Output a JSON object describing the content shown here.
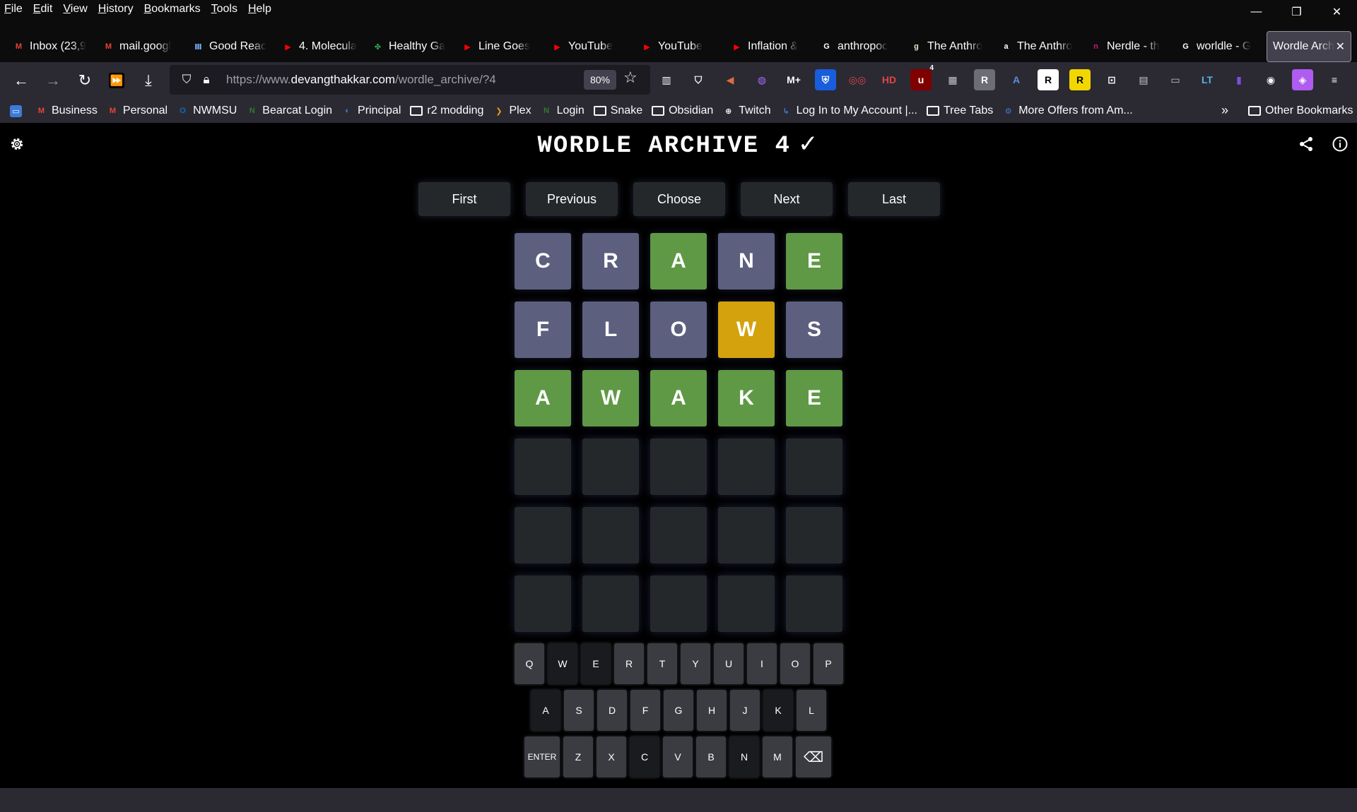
{
  "menubar": {
    "items": [
      "File",
      "Edit",
      "View",
      "History",
      "Bookmarks",
      "Tools",
      "Help"
    ]
  },
  "tabs": [
    {
      "label": "Inbox (23,9",
      "icon": "gmail-icon",
      "color": "#ea4335",
      "glyph": "M"
    },
    {
      "label": "mail.googl",
      "icon": "gmail-icon",
      "color": "#ea4335",
      "glyph": "M"
    },
    {
      "label": "Good Reac",
      "icon": "library-icon",
      "color": "#7ab4ff",
      "glyph": "Ⅲ"
    },
    {
      "label": "4. Molecula",
      "icon": "youtube-icon",
      "color": "#ff0000",
      "glyph": "▶"
    },
    {
      "label": "Healthy Ga",
      "icon": "plant-icon",
      "color": "#2fa84f",
      "glyph": "✤"
    },
    {
      "label": "Line Goes",
      "icon": "youtube-icon",
      "color": "#ff0000",
      "glyph": "▶"
    },
    {
      "label": "YouTube",
      "icon": "youtube-icon",
      "color": "#ff0000",
      "glyph": "▶"
    },
    {
      "label": "YouTube",
      "icon": "youtube-icon",
      "color": "#ff0000",
      "glyph": "▶"
    },
    {
      "label": "Inflation &",
      "icon": "youtube-icon",
      "color": "#ff0000",
      "glyph": "▶"
    },
    {
      "label": "anthropoc",
      "icon": "google-icon",
      "color": "#ffffff",
      "glyph": "G"
    },
    {
      "label": "The Anthro",
      "icon": "goodreads-icon",
      "color": "#e9e5cd",
      "glyph": "g"
    },
    {
      "label": "The Anthro",
      "icon": "amazon-icon",
      "color": "#ffffff",
      "glyph": "a"
    },
    {
      "label": "Nerdle - th",
      "icon": "nerdle-icon",
      "color": "#c81e6e",
      "glyph": "n"
    },
    {
      "label": "worldle - G",
      "icon": "google-icon",
      "color": "#ffffff",
      "glyph": "G"
    }
  ],
  "active_tab": {
    "label": "Wordle Arch",
    "close": "✕"
  },
  "window_controls": {
    "minimize": "—",
    "restore": "❐",
    "close": "✕"
  },
  "nav": {
    "url_prefix": "https://www.",
    "url_host": "devangthakkar.com",
    "url_path": "/wordle_archive/?4",
    "zoom": "80%"
  },
  "bookmarks": [
    {
      "label": "Business",
      "icon": "gmail-icon",
      "color": "#ea4335",
      "glyph": "M"
    },
    {
      "label": "Personal",
      "icon": "gmail-icon",
      "color": "#ea4335",
      "glyph": "M"
    },
    {
      "label": "NWMSU",
      "icon": "outlook-icon",
      "color": "#0f6cbd",
      "glyph": "O"
    },
    {
      "label": "Bearcat Login",
      "icon": "n-icon",
      "color": "#2e7d32",
      "glyph": "N"
    },
    {
      "label": "Principal",
      "icon": "principal-icon",
      "color": "#3d7bd9",
      "glyph": "◐"
    },
    {
      "label": "r2 modding",
      "icon": "folder-icon",
      "color": "",
      "glyph": ""
    },
    {
      "label": "Plex",
      "icon": "plex-icon",
      "color": "#e5a00d",
      "glyph": "❯"
    },
    {
      "label": "Login",
      "icon": "n-icon",
      "color": "#2e7d32",
      "glyph": "N"
    },
    {
      "label": "Snake",
      "icon": "folder-icon",
      "color": "",
      "glyph": ""
    },
    {
      "label": "Obsidian",
      "icon": "folder-icon",
      "color": "",
      "glyph": ""
    },
    {
      "label": "Twitch",
      "icon": "globe-icon",
      "color": "#fbfbfe",
      "glyph": "⊕"
    },
    {
      "label": "Log In to My Account |...",
      "icon": "login-icon",
      "color": "#3d7bd9",
      "glyph": "↳"
    },
    {
      "label": "Tree Tabs",
      "icon": "folder-icon",
      "color": "",
      "glyph": ""
    },
    {
      "label": "More Offers from Am...",
      "icon": "offers-icon",
      "color": "#3d7bd9",
      "glyph": "⚙"
    }
  ],
  "bookmarks_other": "Other Bookmarks",
  "extensions": [
    {
      "name": "fast-forward-icon",
      "glyph": "⏩",
      "bg": "#000000",
      "fg": "#f2d600"
    },
    {
      "name": "download-icon",
      "glyph": "⤓",
      "bg": "transparent",
      "fg": "#fbfbfe"
    }
  ],
  "toolbar_extensions": [
    {
      "name": "reader-view-icon",
      "glyph": "▥",
      "bg": "transparent",
      "fg": "#fbfbfe"
    },
    {
      "name": "pocket-icon",
      "glyph": "⛉",
      "bg": "transparent",
      "fg": "#fbfbfe"
    },
    {
      "name": "speaker-icon",
      "glyph": "◀",
      "bg": "transparent",
      "fg": "#e06b3c"
    },
    {
      "name": "extension-purple-icon",
      "glyph": "◍",
      "bg": "transparent",
      "fg": "#a46bff"
    },
    {
      "name": "m-plus-icon",
      "glyph": "M+",
      "bg": "transparent",
      "fg": "#fbfbfe"
    },
    {
      "name": "bitwarden-icon",
      "glyph": "⛨",
      "bg": "#175ddc",
      "fg": "#ffffff"
    },
    {
      "name": "glasses-icon",
      "glyph": "◎◎",
      "bg": "transparent",
      "fg": "#e04444"
    },
    {
      "name": "hd-icon",
      "glyph": "HD",
      "bg": "transparent",
      "fg": "#e04444"
    },
    {
      "name": "ublock-icon",
      "glyph": "u",
      "bg": "#800000",
      "fg": "#ffffff"
    },
    {
      "name": "extension-grid-icon",
      "glyph": "▦",
      "bg": "transparent",
      "fg": "#c7c7d0"
    },
    {
      "name": "extension-r-gray-icon",
      "glyph": "R",
      "bg": "#6d6d78",
      "fg": "#ffffff"
    },
    {
      "name": "font-icon",
      "glyph": "A",
      "bg": "transparent",
      "fg": "#5b8ede"
    },
    {
      "name": "extension-r-white-icon",
      "glyph": "R",
      "bg": "#ffffff",
      "fg": "#000000"
    },
    {
      "name": "extension-r-yellow-icon",
      "glyph": "R",
      "bg": "#f2d600",
      "fg": "#000000"
    },
    {
      "name": "screenshot-icon",
      "glyph": "⊡",
      "bg": "transparent",
      "fg": "#fbfbfe"
    },
    {
      "name": "document-icon",
      "glyph": "▤",
      "bg": "transparent",
      "fg": "#c7c7d0"
    },
    {
      "name": "chat-icon",
      "glyph": "▭",
      "bg": "transparent",
      "fg": "#c7c7d0"
    },
    {
      "name": "languagetool-icon",
      "glyph": "LT",
      "bg": "transparent",
      "fg": "#5ab0e0"
    },
    {
      "name": "extension-purple-b-icon",
      "glyph": "▮",
      "bg": "transparent",
      "fg": "#7b4fe0"
    },
    {
      "name": "privacy-icon",
      "glyph": "◉",
      "bg": "transparent",
      "fg": "#fbfbfe"
    },
    {
      "name": "extension-violet-icon",
      "glyph": "◈",
      "bg": "#b05cf0",
      "fg": "#ffffff"
    },
    {
      "name": "hamburger-menu-icon",
      "glyph": "≡",
      "bg": "transparent",
      "fg": "#fbfbfe"
    }
  ],
  "ublock_badge": "4",
  "game": {
    "title": "WORDLE ARCHIVE 4",
    "check": "✓",
    "nav_buttons": [
      "First",
      "Previous",
      "Choose",
      "Next",
      "Last"
    ],
    "colors": {
      "correct": "#5f9945",
      "present": "#d3a20c",
      "absent": "#5d5f7f",
      "empty": "#25282b"
    },
    "board": [
      [
        {
          "l": "C",
          "s": "absent"
        },
        {
          "l": "R",
          "s": "absent"
        },
        {
          "l": "A",
          "s": "correct"
        },
        {
          "l": "N",
          "s": "absent"
        },
        {
          "l": "E",
          "s": "correct"
        }
      ],
      [
        {
          "l": "F",
          "s": "absent"
        },
        {
          "l": "L",
          "s": "absent"
        },
        {
          "l": "O",
          "s": "absent"
        },
        {
          "l": "W",
          "s": "present"
        },
        {
          "l": "S",
          "s": "absent"
        }
      ],
      [
        {
          "l": "A",
          "s": "correct"
        },
        {
          "l": "W",
          "s": "correct"
        },
        {
          "l": "A",
          "s": "correct"
        },
        {
          "l": "K",
          "s": "correct"
        },
        {
          "l": "E",
          "s": "correct"
        }
      ],
      [
        {
          "l": "",
          "s": "empty"
        },
        {
          "l": "",
          "s": "empty"
        },
        {
          "l": "",
          "s": "empty"
        },
        {
          "l": "",
          "s": "empty"
        },
        {
          "l": "",
          "s": "empty"
        }
      ],
      [
        {
          "l": "",
          "s": "empty"
        },
        {
          "l": "",
          "s": "empty"
        },
        {
          "l": "",
          "s": "empty"
        },
        {
          "l": "",
          "s": "empty"
        },
        {
          "l": "",
          "s": "empty"
        }
      ],
      [
        {
          "l": "",
          "s": "empty"
        },
        {
          "l": "",
          "s": "empty"
        },
        {
          "l": "",
          "s": "empty"
        },
        {
          "l": "",
          "s": "empty"
        },
        {
          "l": "",
          "s": "empty"
        }
      ]
    ],
    "keyboard": [
      [
        {
          "k": "Q",
          "s": "absent"
        },
        {
          "k": "W",
          "s": "correct"
        },
        {
          "k": "E",
          "s": "correct"
        },
        {
          "k": "R",
          "s": "absent"
        },
        {
          "k": "T",
          "s": "absent"
        },
        {
          "k": "Y",
          "s": "absent"
        },
        {
          "k": "U",
          "s": "absent"
        },
        {
          "k": "I",
          "s": "absent"
        },
        {
          "k": "O",
          "s": "absent"
        },
        {
          "k": "P",
          "s": "absent"
        }
      ],
      [
        {
          "k": "A",
          "s": "correct"
        },
        {
          "k": "S",
          "s": "absent"
        },
        {
          "k": "D",
          "s": "absent"
        },
        {
          "k": "F",
          "s": "absent"
        },
        {
          "k": "G",
          "s": "absent"
        },
        {
          "k": "H",
          "s": "absent"
        },
        {
          "k": "J",
          "s": "absent"
        },
        {
          "k": "K",
          "s": "correct"
        },
        {
          "k": "L",
          "s": "absent"
        }
      ],
      [
        {
          "k": "ENTER",
          "s": "absent"
        },
        {
          "k": "Z",
          "s": "absent"
        },
        {
          "k": "X",
          "s": "absent"
        },
        {
          "k": "C",
          "s": "correct"
        },
        {
          "k": "V",
          "s": "absent"
        },
        {
          "k": "B",
          "s": "absent"
        },
        {
          "k": "N",
          "s": "correct"
        },
        {
          "k": "M",
          "s": "absent"
        },
        {
          "k": "⌫",
          "s": "absent"
        }
      ]
    ]
  }
}
